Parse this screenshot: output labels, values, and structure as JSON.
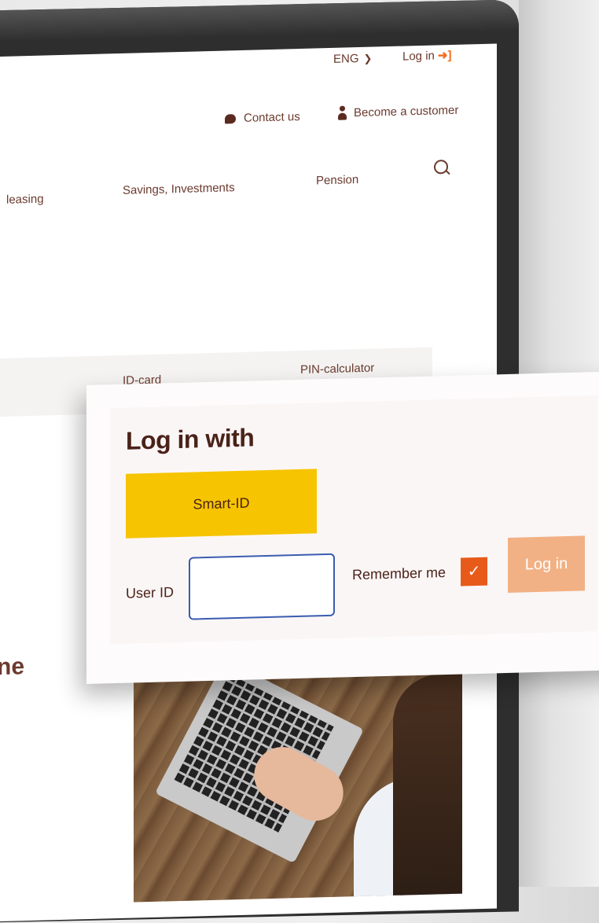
{
  "header": {
    "language": "ENG",
    "login_link": "Log in",
    "contact": "Contact us",
    "become_customer": "Become a customer"
  },
  "nav": {
    "items": [
      "leasing",
      "Savings, Investments",
      "Pension"
    ]
  },
  "subnav": {
    "items": [
      "ID-card",
      "PIN-calculator"
    ]
  },
  "body": {
    "fragment": "ne"
  },
  "login_card": {
    "title": "Log in with",
    "smart_id_button": "Smart-ID",
    "user_id_label": "User ID",
    "user_id_value": "",
    "remember_label": "Remember me",
    "remember_checked": true,
    "login_button": "Log in"
  },
  "colors": {
    "brand_brown": "#6b3a2e",
    "smart_id_yellow": "#f6c400",
    "accent_orange": "#e85a1a",
    "login_button": "#f2b184"
  }
}
